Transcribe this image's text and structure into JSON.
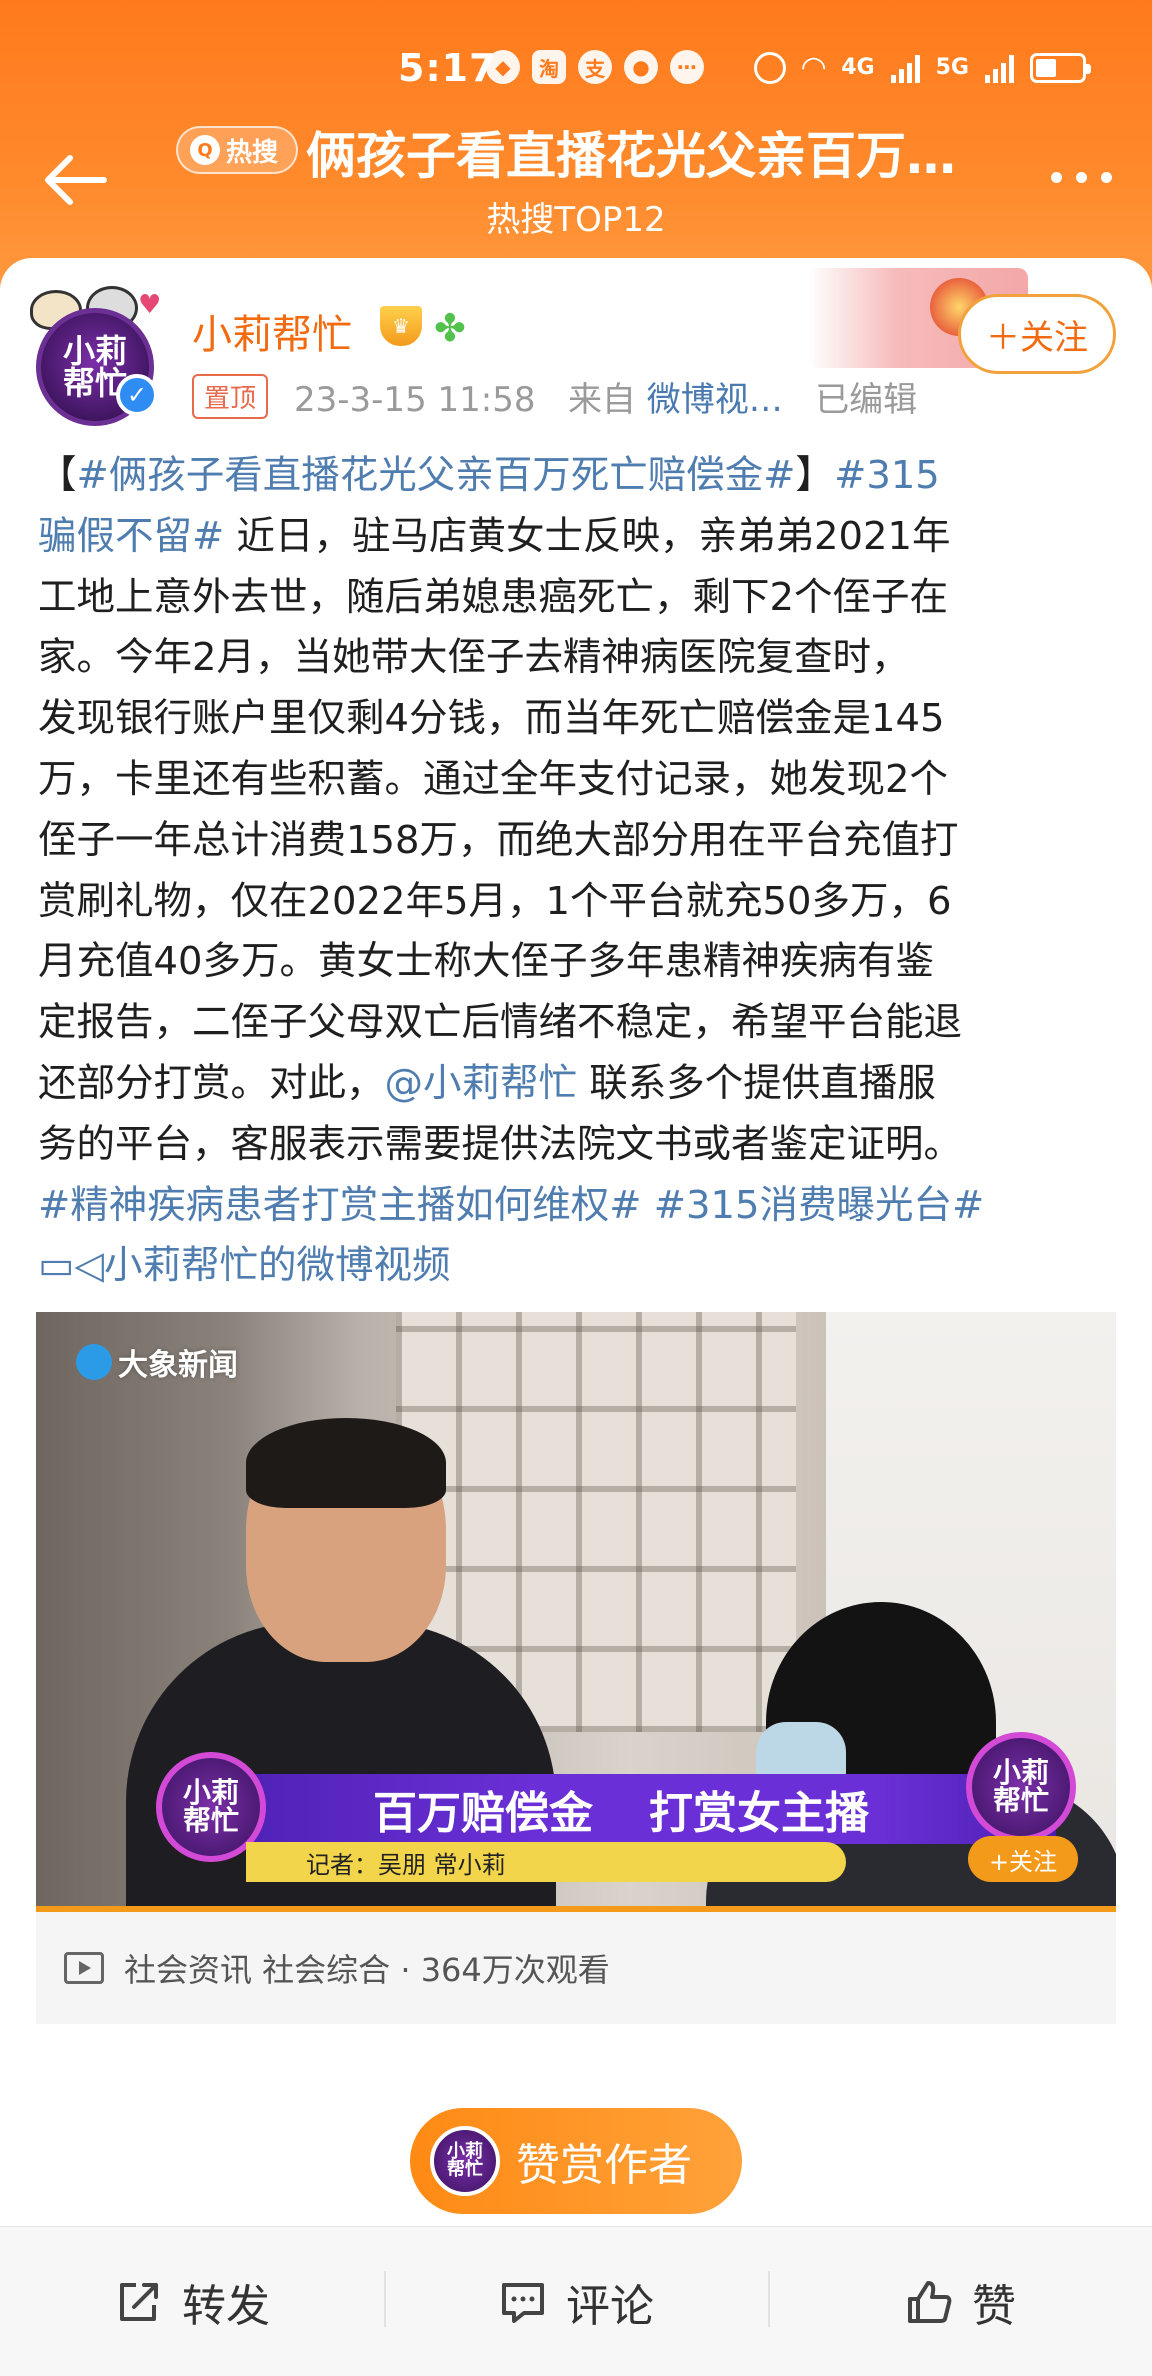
{
  "status_bar": {
    "time": "5:17",
    "network_4g": "4G",
    "network_5g": "5G"
  },
  "header": {
    "hot_pill": "热搜",
    "title": "俩孩子看直播花光父亲百万…",
    "subtitle": "热搜TOP12"
  },
  "post": {
    "author": "小莉帮忙",
    "pinned_label": "置顶",
    "meta": {
      "date": "23-3-15 11:58",
      "from_label": "来自",
      "source": "微博视…",
      "edited": "已编辑"
    },
    "follow_label": "＋关注",
    "body": {
      "l1_a": "【",
      "l1_tag": "#俩孩子看直播花光父亲百万死亡赔偿金#",
      "l1_b": "】",
      "l1_tag2": "#315",
      "l2_tag": "骗假不留#",
      "l2_text": " 近日，驻马店黄女士反映，亲弟弟2021年",
      "l3": "工地上意外去世，随后弟媳患癌死亡，剩下2个侄子在",
      "l4": "家。今年2月，当她带大侄子去精神病医院复查时，",
      "l5": "发现银行账户里仅剩4分钱，而当年死亡赔偿金是145",
      "l6": "万，卡里还有些积蓄。通过全年支付记录，她发现2个",
      "l7": "侄子一年总计消费158万，而绝大部分用在平台充值打",
      "l8": "赏刷礼物，仅在2022年5月，1个平台就充50多万，6",
      "l9": "月充值40多万。黄女士称大侄子多年患精神疾病有鉴",
      "l10": "定报告，二侄子父母双亡后情绪不稳定，希望平台能退",
      "l11_a": "还部分打赏。对此，",
      "l11_mention": "@小莉帮忙",
      "l11_b": " 联系多个提供直播服",
      "l12": "务的平台，客服表示需要提供法院文书或者鉴定证明。",
      "l13_tag1": "#精神疾病患者打赏主播如何维权#",
      "l13_tag2": " #315消费曝光台#",
      "l14_video": "小莉帮忙的微博视频"
    },
    "video": {
      "watermark": "大象新闻",
      "banner_left": "百万赔偿金",
      "banner_right": "打赏女主播",
      "reporter": "记者：吴朋 常小莉",
      "badge_text": "小莉\n帮忙",
      "follow_label": "+关注",
      "category_info": "社会资讯 社会综合 · 364万次观看"
    },
    "tip_label": "赞赏作者"
  },
  "actions": {
    "repost": "转发",
    "comment": "评论",
    "like": "赞"
  },
  "colors": {
    "header_orange": "#ff7a1c",
    "link_blue": "#507daf",
    "name_orange": "#f26b11"
  }
}
